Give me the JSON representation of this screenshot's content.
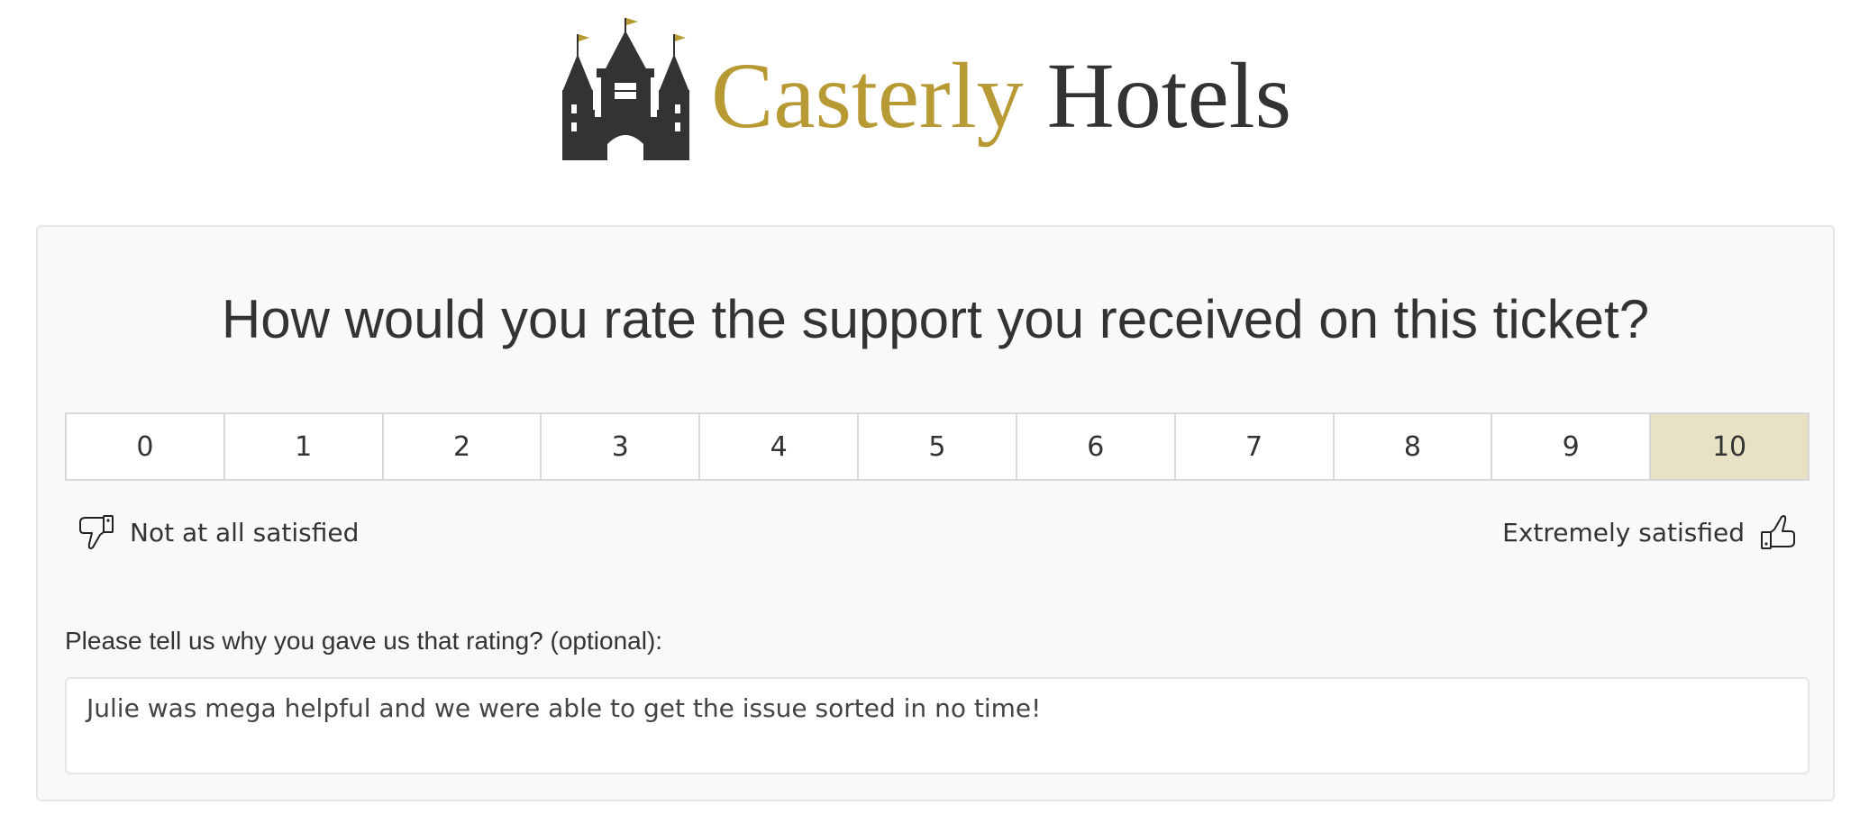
{
  "brand": {
    "name_part1": "Casterly",
    "name_part2": "Hotels",
    "gold_color": "#b89a35",
    "dark_color": "#333333",
    "logo_icon": "castle-icon"
  },
  "survey": {
    "question": "How would you rate the support you received on this ticket?",
    "scale": [
      "0",
      "1",
      "2",
      "3",
      "4",
      "5",
      "6",
      "7",
      "8",
      "9",
      "10"
    ],
    "selected": "10",
    "selected_color": "#e9e1c6",
    "low_label": "Not at all satisfied",
    "low_icon": "thumbs-down-icon",
    "high_label": "Extremely satisfied",
    "high_icon": "thumbs-up-icon",
    "reason_label": "Please tell us why you gave us that rating? (optional):",
    "reason_value": "Julie was mega helpful and we were able to get the issue sorted in no time!"
  }
}
